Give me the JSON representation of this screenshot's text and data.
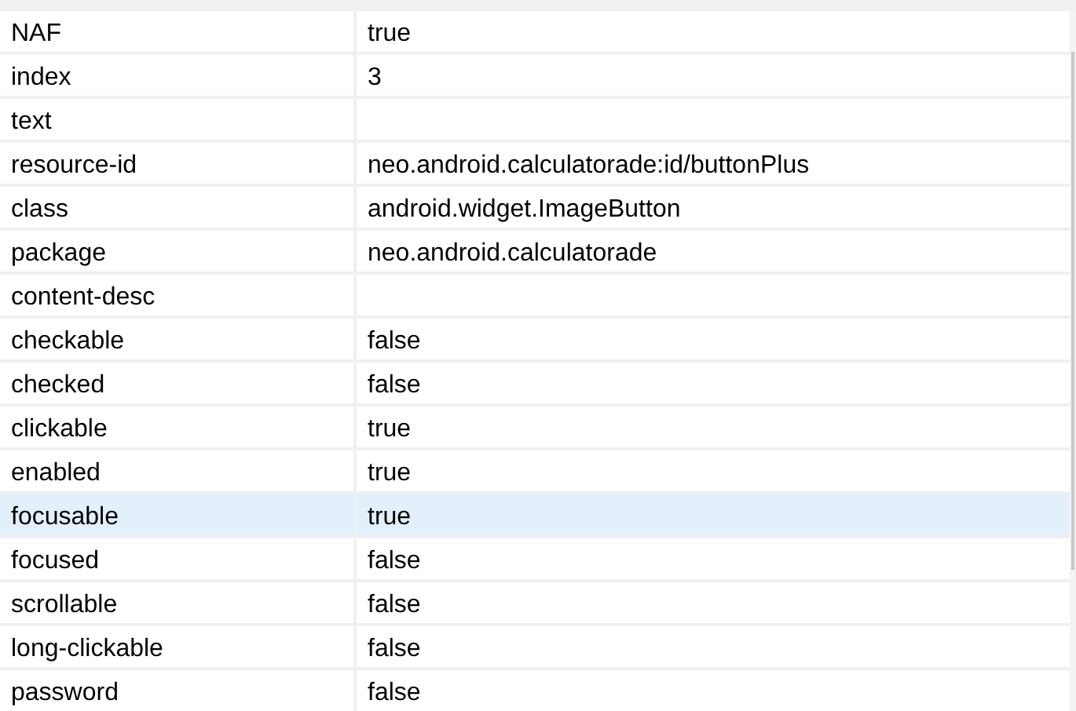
{
  "rows": [
    {
      "name": "NAF",
      "value": "true",
      "selected": false
    },
    {
      "name": "index",
      "value": "3",
      "selected": false
    },
    {
      "name": "text",
      "value": "",
      "selected": false
    },
    {
      "name": "resource-id",
      "value": "neo.android.calculatorade:id/buttonPlus",
      "selected": false
    },
    {
      "name": "class",
      "value": "android.widget.ImageButton",
      "selected": false
    },
    {
      "name": "package",
      "value": "neo.android.calculatorade",
      "selected": false
    },
    {
      "name": "content-desc",
      "value": "",
      "selected": false
    },
    {
      "name": "checkable",
      "value": "false",
      "selected": false
    },
    {
      "name": "checked",
      "value": "false",
      "selected": false
    },
    {
      "name": "clickable",
      "value": "true",
      "selected": false
    },
    {
      "name": "enabled",
      "value": "true",
      "selected": false
    },
    {
      "name": "focusable",
      "value": "true",
      "selected": true
    },
    {
      "name": "focused",
      "value": "false",
      "selected": false
    },
    {
      "name": "scrollable",
      "value": "false",
      "selected": false
    },
    {
      "name": "long-clickable",
      "value": "false",
      "selected": false
    },
    {
      "name": "password",
      "value": "false",
      "selected": false
    }
  ]
}
